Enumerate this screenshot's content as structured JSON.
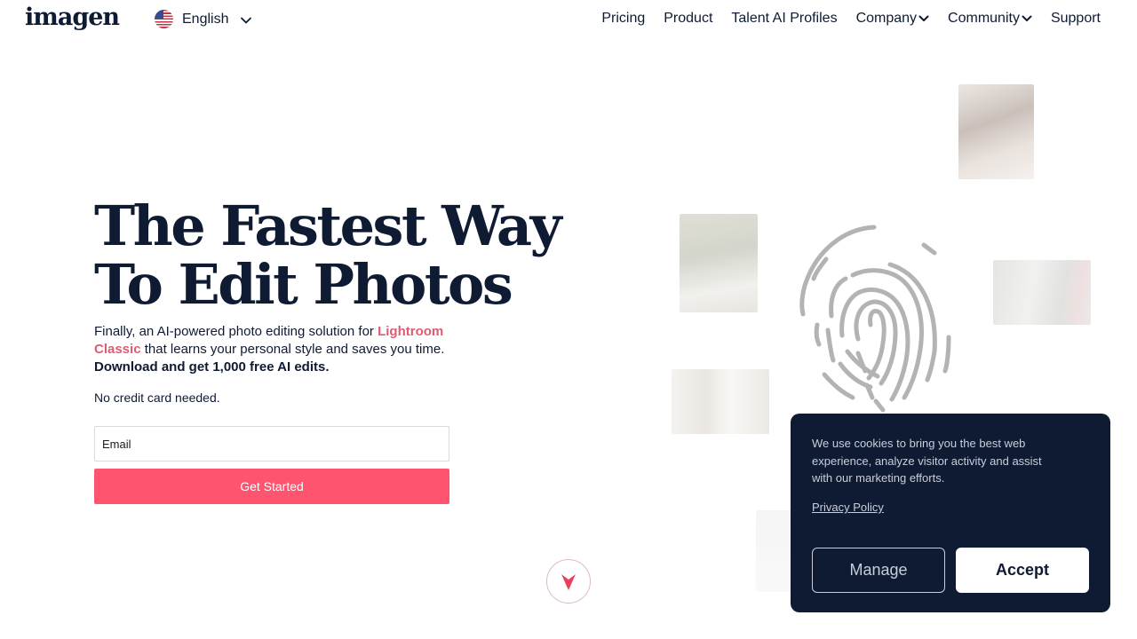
{
  "header": {
    "logo_text": "imagen",
    "language": {
      "label": "English",
      "flag_icon": "us-flag-icon"
    },
    "nav": [
      {
        "label": "Pricing",
        "has_dropdown": false
      },
      {
        "label": "Product",
        "has_dropdown": false
      },
      {
        "label": "Talent AI Profiles",
        "has_dropdown": false
      },
      {
        "label": "Company",
        "has_dropdown": true
      },
      {
        "label": "Community",
        "has_dropdown": true
      },
      {
        "label": "Support",
        "has_dropdown": false
      }
    ]
  },
  "hero": {
    "title_line1": "The Fastest Way",
    "title_line2": "To Edit Photos",
    "desc_prefix": "Finally, an AI-powered photo editing solution for ",
    "desc_accent": "Lightroom Classic",
    "desc_suffix": " that learns your personal style and saves you time.",
    "desc_strong": "Download and get 1,000 free AI edits.",
    "no_card": "No credit card needed.",
    "email_placeholder": "Email",
    "cta_label": "Get Started"
  },
  "cookie_banner": {
    "text": "We use cookies to bring you the best web experience, analyze visitor activity and assist with our marketing efforts.",
    "privacy_link": "Privacy Policy",
    "manage_label": "Manage",
    "accept_label": "Accept"
  },
  "colors": {
    "navy": "#0e1b33",
    "accent_pink": "#ff5470",
    "accent_text": "#e05b72",
    "cookie_bg": "#0e1b33"
  }
}
